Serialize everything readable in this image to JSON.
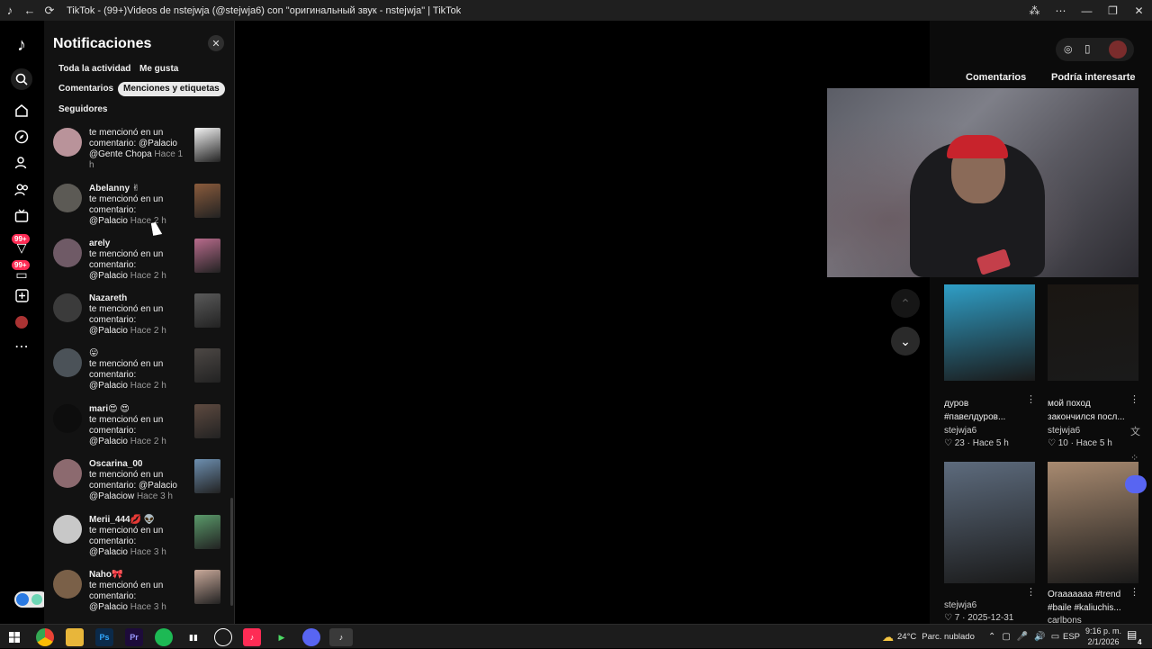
{
  "window": {
    "title": "TikTok - (99+)Videos de nstejwja (@stejwja6) con \"оригинальный звук - nstejwja\" | TikTok"
  },
  "rail": {
    "badge_inbox": "99+",
    "badge_activity": "99+"
  },
  "notifications": {
    "title": "Notificaciones",
    "filters": [
      "Toda la actividad",
      "Me gusta",
      "Comentarios",
      "Menciones y etiquetas",
      "Seguidores"
    ],
    "active_filter": "Menciones y etiquetas",
    "items": [
      {
        "name": "",
        "line1": "te mencionó en un",
        "line2": "comentario: @Palacio",
        "line3": "@Gente Chopa",
        "time": "Hace 1 h",
        "avatar_color": "#b9939a",
        "thumb_color": "#f2f2f2"
      },
      {
        "name": "Abelanny ✌",
        "line1": "te mencionó en un",
        "line2": "comentario:",
        "line3": "@Palacio",
        "time": "Hace 2 h",
        "avatar_color": "#5c5a55",
        "thumb_color": "#8a5b3c"
      },
      {
        "name": "arely",
        "line1": "te mencionó en un",
        "line2": "comentario:",
        "line3": "@Palacio",
        "time": "Hace 2 h",
        "avatar_color": "#6f5a66",
        "thumb_color": "#b86b8c"
      },
      {
        "name": "Nazareth",
        "line1": "te mencionó en un",
        "line2": "comentario:",
        "line3": "@Palacio",
        "time": "Hace 2 h",
        "avatar_color": "#3b3b3b",
        "thumb_color": "#5a5a5a"
      },
      {
        "name": "😛",
        "line1": "te mencionó en un",
        "line2": "comentario:",
        "line3": "@Palacio",
        "time": "Hace 2 h",
        "avatar_color": "#4b5258",
        "thumb_color": "#4d4845"
      },
      {
        "name": "mari😍 😍",
        "line1": "te mencionó en un",
        "line2": "comentario:",
        "line3": "@Palacio",
        "time": "Hace 2 h",
        "avatar_color": "#0d0d0d",
        "thumb_color": "#5e4a40"
      },
      {
        "name": "Oscarina_00",
        "line1": "te mencionó en un",
        "line2": "comentario: @Palacio",
        "line3": "@Palaciow",
        "time": "Hace 3 h",
        "avatar_color": "#8c6a6f",
        "thumb_color": "#6d8fb0"
      },
      {
        "name": "Merii_444💋 👽",
        "line1": "te mencionó en un",
        "line2": "comentario:",
        "line3": "@Palacio",
        "time": "Hace 3 h",
        "avatar_color": "#c8c8c8",
        "thumb_color": "#5a9a6a"
      },
      {
        "name": "Naho🎀",
        "line1": "te mencionó en un",
        "line2": "comentario:",
        "line3": "@Palacio",
        "time": "Hace 3 h",
        "avatar_color": "#7a6048",
        "thumb_color": "#c9a99a"
      }
    ]
  },
  "right_panel": {
    "tabs": [
      "Comentarios",
      "Podría interesarte"
    ],
    "cards": [
      {
        "title1": "дуров",
        "title2": "#павелдуров...",
        "author": "stejwja6",
        "likes": "23",
        "age": "Hace 5 h",
        "thumb_color": "#2f9ec6"
      },
      {
        "title1": "мой поход",
        "title2": "закончился посл...",
        "author": "stejwja6",
        "likes": "10",
        "age": "Hace 5 h",
        "thumb_color": "#1a1612"
      },
      {
        "title1": "",
        "title2": "",
        "author": "stejwja6",
        "likes": "7",
        "age": "2025-12-31",
        "thumb_color": "#5d6b7d"
      },
      {
        "title1": "Oraaaaaaa #trend",
        "title2": "#baile #kaliuchis...",
        "author": "carlbons",
        "likes": "",
        "age": "",
        "thumb_color": "#a88a70"
      }
    ]
  },
  "taskbar": {
    "weather_temp": "24°C",
    "weather_text": "Parc. nublado",
    "language": "ESP",
    "time": "9:16 p. m.",
    "date": "2/1/2026",
    "notif_count": "4"
  }
}
